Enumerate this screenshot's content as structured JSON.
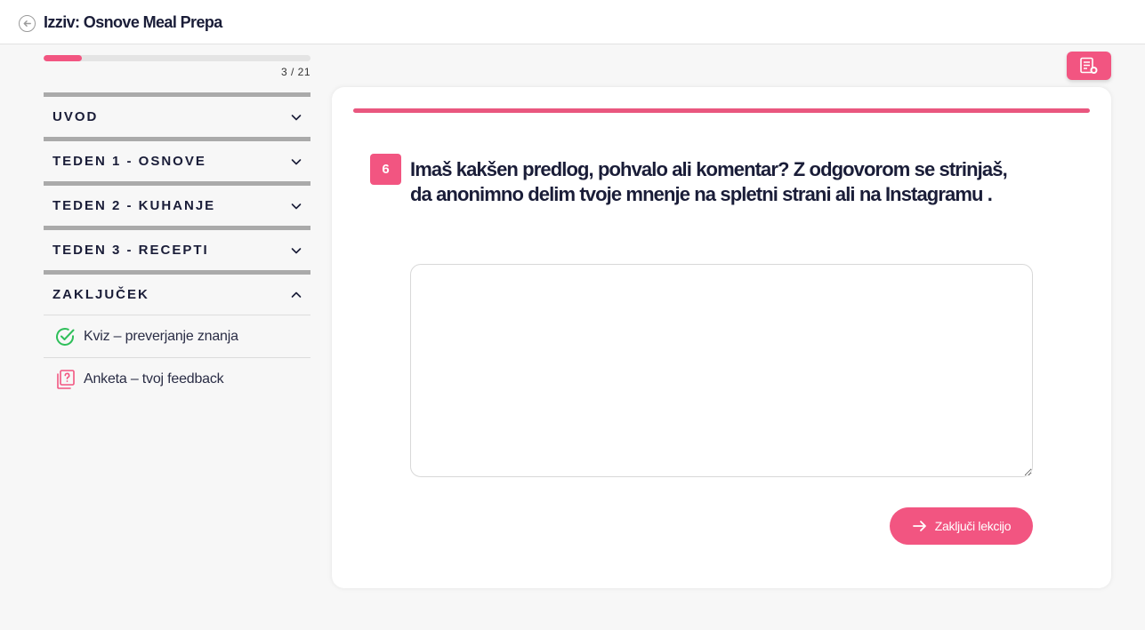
{
  "header": {
    "title": "Izziv: Osnove Meal Prepa",
    "back_icon": "arrow-left-circle-icon"
  },
  "progress": {
    "current": 3,
    "total": 21,
    "label": "3 / 21",
    "fraction": 0.143
  },
  "sidebar": {
    "sections": [
      {
        "label": "UVOD",
        "expanded": false
      },
      {
        "label": "TEDEN 1 - OSNOVE",
        "expanded": false
      },
      {
        "label": "TEDEN 2 - KUHANJE",
        "expanded": false
      },
      {
        "label": "TEDEN 3 - RECEPTI",
        "expanded": false
      },
      {
        "label": "ZAKLJUČEK",
        "expanded": true
      }
    ],
    "lessons": [
      {
        "label": "Kviz – preverjanje znanja",
        "icon": "check-circle-icon",
        "status": "completed"
      },
      {
        "label": "Anketa – tvoj feedback",
        "icon": "question-document-icon",
        "status": "current"
      }
    ]
  },
  "question": {
    "number": "6",
    "text": "Imaš kakšen predlog, pohvalo ali komentar? Z odgovorom se strinjaš, da anonimno delim tvoje mnenje na spletni strani ali na Instagramu .",
    "answer_value": ""
  },
  "actions": {
    "submit_label": "Zaključi lekcijo",
    "notes_icon": "notes-icon"
  },
  "colors": {
    "accent": "#f25581",
    "check": "#2fbf5a",
    "section_border": "#aaaaaa",
    "background": "#f7f7f7"
  }
}
